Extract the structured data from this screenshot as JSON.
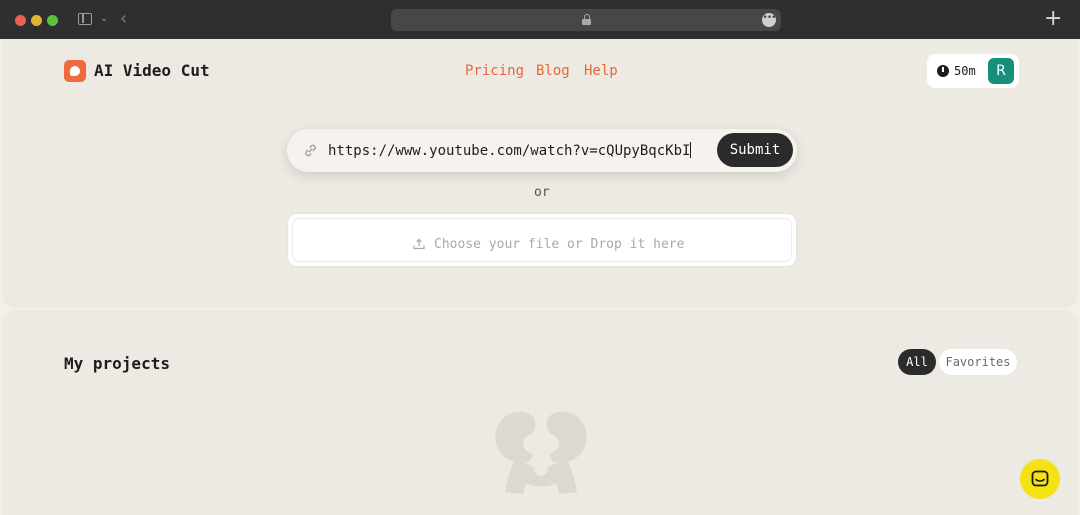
{
  "browser": {
    "icons": [
      "sidebar-toggle-icon",
      "chevron-down-icon",
      "back-arrow-icon",
      "lock-icon",
      "more-icon",
      "new-tab-icon"
    ]
  },
  "header": {
    "brand": "AI Video Cut",
    "nav": [
      {
        "label": "Pricing"
      },
      {
        "label": "Blog"
      },
      {
        "label": "Help"
      }
    ],
    "credits": "50m",
    "avatar_initial": "R"
  },
  "input": {
    "url_value": "https://www.youtube.com/watch?v=cQUpyBqcKbI",
    "submit_label": "Submit",
    "or_label": "or",
    "upload_label": "Choose your file or Drop it here"
  },
  "projects": {
    "title": "My projects",
    "filters": [
      {
        "label": "All",
        "active": true
      },
      {
        "label": "Favorites",
        "active": false
      }
    ]
  },
  "colors": {
    "accent": "#e8663c",
    "dark": "#2b2b2b",
    "avatar": "#17907b",
    "chat": "#f5e214"
  }
}
